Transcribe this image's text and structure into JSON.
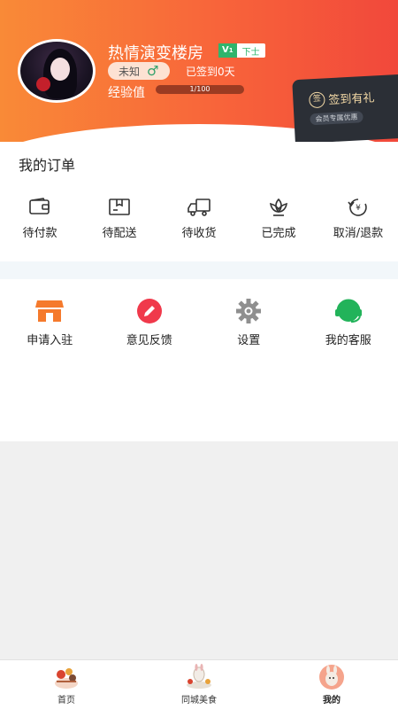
{
  "profile": {
    "username": "热情演变楼房",
    "vip_letter": "V",
    "vip_level": "1",
    "rank": "下士",
    "gender_text": "未知",
    "gender_symbol": "♂",
    "signin_days": "已签到0天",
    "exp_label": "经验值",
    "exp_progress_text": "1/100",
    "exp_progress_fraction": 0.01
  },
  "checkin_card": {
    "coin_symbol": "签",
    "title": "签到有礼",
    "subtitle": "会员专属优惠"
  },
  "orders": {
    "heading": "我的订单",
    "items": [
      {
        "label": "待付款",
        "icon": "wallet-icon"
      },
      {
        "label": "待配送",
        "icon": "package-icon"
      },
      {
        "label": "待收货",
        "icon": "truck-icon"
      },
      {
        "label": "已完成",
        "icon": "lotus-icon"
      },
      {
        "label": "取消/退款",
        "icon": "refund-icon"
      }
    ]
  },
  "services": {
    "items": [
      {
        "label": "申请入驻",
        "icon": "store-icon"
      },
      {
        "label": "意见反馈",
        "icon": "pencil-icon"
      },
      {
        "label": "设置",
        "icon": "gear-icon"
      },
      {
        "label": "我的客服",
        "icon": "headset-icon"
      }
    ]
  },
  "tabbar": {
    "items": [
      {
        "label": "首页",
        "icon": "home-illustration-icon"
      },
      {
        "label": "同城美食",
        "icon": "food-illustration-icon"
      },
      {
        "label": "我的",
        "icon": "profile-illustration-icon",
        "active": true
      }
    ]
  },
  "colors": {
    "header_start": "#f98a37",
    "header_end": "#f1483b",
    "vip_green": "#2fb56c",
    "store_orange": "#f57a2c",
    "feedback_red": "#f0394b",
    "gear_gray": "#8f8f8f",
    "service_green": "#22b35a"
  }
}
